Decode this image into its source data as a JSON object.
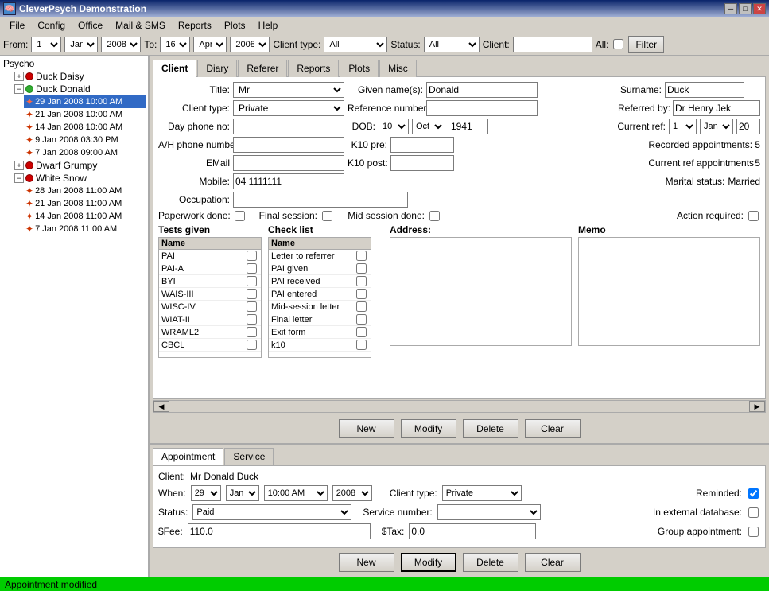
{
  "titleBar": {
    "title": "CleverPsych Demonstration",
    "minBtn": "─",
    "maxBtn": "□",
    "closeBtn": "✕"
  },
  "menuBar": {
    "items": [
      "File",
      "Config",
      "Office",
      "Mail & SMS",
      "Reports",
      "Plots",
      "Help"
    ]
  },
  "toolbar": {
    "fromLabel": "From:",
    "fromDay": "1",
    "fromMonth": "Jan",
    "fromYear": "2008",
    "toLabel": "To:",
    "toDay": "16",
    "toMonth": "Apr",
    "toYear": "2008",
    "clientTypeLabel": "Client type:",
    "clientTypeValue": "All",
    "statusLabel": "Status:",
    "statusValue": "All",
    "clientLabel": "Client:",
    "allLabel": "All:",
    "filterBtn": "Filter"
  },
  "tree": {
    "root": "Psycho",
    "items": [
      {
        "label": "Duck Daisy",
        "type": "client",
        "color": "red",
        "expanded": false,
        "indent": 1
      },
      {
        "label": "Duck Donald",
        "type": "client",
        "color": "green",
        "expanded": true,
        "indent": 1
      },
      {
        "label": "29 Jan 2008 10:00 AM",
        "type": "appointment",
        "selected": true,
        "indent": 2
      },
      {
        "label": "21 Jan 2008 10:00 AM",
        "type": "appointment",
        "indent": 2
      },
      {
        "label": "14 Jan 2008 10:00 AM",
        "type": "appointment",
        "indent": 2
      },
      {
        "label": "9 Jan 2008 03:30 PM",
        "type": "appointment",
        "indent": 2
      },
      {
        "label": "7 Jan 2008 09:00 AM",
        "type": "appointment",
        "indent": 2
      },
      {
        "label": "Dwarf Grumpy",
        "type": "client",
        "color": "red",
        "expanded": false,
        "indent": 1
      },
      {
        "label": "White Snow",
        "type": "client",
        "color": "red",
        "expanded": true,
        "indent": 1
      },
      {
        "label": "28 Jan 2008 11:00 AM",
        "type": "appointment",
        "indent": 2
      },
      {
        "label": "21 Jan 2008 11:00 AM",
        "type": "appointment",
        "indent": 2
      },
      {
        "label": "14 Jan 2008 11:00 AM",
        "type": "appointment",
        "indent": 2
      },
      {
        "label": "7 Jan 2008 11:00 AM",
        "type": "appointment",
        "indent": 2
      }
    ]
  },
  "clientTabs": [
    "Client",
    "Diary",
    "Referer",
    "Reports",
    "Plots",
    "Misc"
  ],
  "clientTabActive": "Client",
  "clientForm": {
    "titleLabel": "Title:",
    "titleValue": "Mr",
    "givenNamesLabel": "Given name(s):",
    "givenNamesValue": "Donald",
    "surnameLabel": "Surname:",
    "surnameValue": "Duck",
    "clientTypeLabel": "Client type:",
    "clientTypeValue": "Private",
    "referenceLabel": "Reference number:",
    "referenceValue": "",
    "referredByLabel": "Referred by:",
    "referredByValue": "Dr Henry Jek",
    "dayPhoneLabel": "Day phone no:",
    "dayPhoneValue": "",
    "dobLabel": "DOB:",
    "dobDay": "10",
    "dobMonth": "Oct",
    "dobYear": "1941",
    "currentRefLabel": "Current ref:",
    "currentRefNum": "1",
    "currentRefMonth": "Jan",
    "currentRefYear": "20",
    "ahPhoneLabel": "A/H phone number:",
    "ahPhoneValue": "",
    "k10preLabel": "K10 pre:",
    "k10preValue": "",
    "recordedLabel": "Recorded appointments:",
    "recordedValue": "5",
    "k10postLabel": "K10 post:",
    "k10postValue": "",
    "currentRefAptsLabel": "Current ref appointments:",
    "currentRefAptsValue": "5",
    "emailLabel": "EMail",
    "emailValue": "",
    "mobileLabel": "Mobile:",
    "mobileValue": "04 1111111",
    "maritalLabel": "Marital status:",
    "maritalValue": "Married",
    "occupationLabel": "Occupation:",
    "occupationValue": "",
    "paperworkDoneLabel": "Paperwork done:",
    "finalSessionLabel": "Final session:",
    "midSessionDoneLabel": "Mid session done:",
    "actionRequiredLabel": "Action required:",
    "testsGivenLabel": "Tests given",
    "checkListLabel": "Check list",
    "addressLabel": "Address:",
    "memoLabel": "Memo",
    "tests": [
      {
        "name": "PAI",
        "checked": false
      },
      {
        "name": "PAI-A",
        "checked": false
      },
      {
        "name": "BYI",
        "checked": false
      },
      {
        "name": "WAIS-III",
        "checked": false
      },
      {
        "name": "WISC-IV",
        "checked": false
      },
      {
        "name": "WIAT-II",
        "checked": false
      },
      {
        "name": "WRAML2",
        "checked": false
      },
      {
        "name": "CBCL",
        "checked": false
      }
    ],
    "checklist": [
      {
        "name": "Letter to referrer",
        "checked": false
      },
      {
        "name": "PAI given",
        "checked": false
      },
      {
        "name": "PAI received",
        "checked": false
      },
      {
        "name": "PAI entered",
        "checked": false
      },
      {
        "name": "Mid-session letter",
        "checked": false
      },
      {
        "name": "Final letter",
        "checked": false
      },
      {
        "name": "Exit form",
        "checked": false
      },
      {
        "name": "k10",
        "checked": false
      }
    ]
  },
  "clientButtons": {
    "new": "New",
    "modify": "Modify",
    "delete": "Delete",
    "clear": "Clear"
  },
  "bottomTabs": [
    "Appointment",
    "Service"
  ],
  "bottomTabActive": "Appointment",
  "appointmentForm": {
    "clientLabel": "Client:",
    "clientValue": "Mr Donald Duck",
    "whenLabel": "When:",
    "whenDay": "29",
    "whenMonth": "Jan",
    "whenTime": "10:00 AM",
    "whenYear": "2008",
    "clientTypeLabel": "Client type:",
    "clientTypeValue": "Private",
    "remindedLabel": "Reminded:",
    "remindedChecked": true,
    "statusLabel": "Status:",
    "statusValue": "Paid",
    "serviceNumberLabel": "Service number:",
    "serviceNumberValue": "",
    "inExternalLabel": "In external database:",
    "feeLabel": "$Fee:",
    "feeValue": "110.0",
    "taxLabel": "$Tax:",
    "taxValue": "0.0",
    "groupAptLabel": "Group appointment:"
  },
  "appointmentButtons": {
    "new": "New",
    "modify": "Modify",
    "delete": "Delete",
    "clear": "Clear"
  },
  "statusBar": {
    "text": "Appointment modified"
  }
}
